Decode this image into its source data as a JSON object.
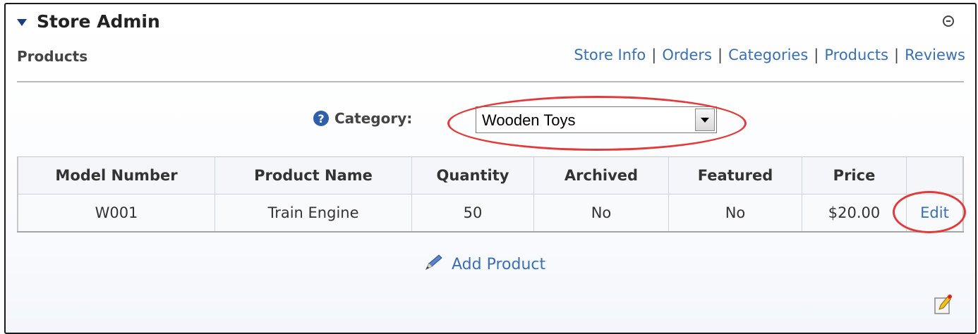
{
  "module": {
    "title": "Store Admin",
    "subtitle": "Products"
  },
  "nav": {
    "store_info": "Store Info",
    "orders": "Orders",
    "categories": "Categories",
    "products": "Products",
    "reviews": "Reviews",
    "separator": "|"
  },
  "category": {
    "label": "Category:",
    "selected": "Wooden Toys"
  },
  "table": {
    "headers": [
      "Model Number",
      "Product Name",
      "Quantity",
      "Archived",
      "Featured",
      "Price",
      ""
    ],
    "rows": [
      {
        "model_number": "W001",
        "product_name": "Train Engine",
        "quantity": "50",
        "archived": "No",
        "featured": "No",
        "price": "$20.00",
        "action": "Edit"
      }
    ]
  },
  "actions": {
    "add_product": "Add Product"
  },
  "colors": {
    "link": "#3a6fb0",
    "highlight": "#e23a3a",
    "title_icon": "#1d3b83"
  },
  "icons": {
    "collapse": "minus-circle-icon",
    "help": "question-circle-icon",
    "add_product": "pencil-icon",
    "edit_module": "edit-module-icon",
    "title": "triangle-down-icon"
  }
}
